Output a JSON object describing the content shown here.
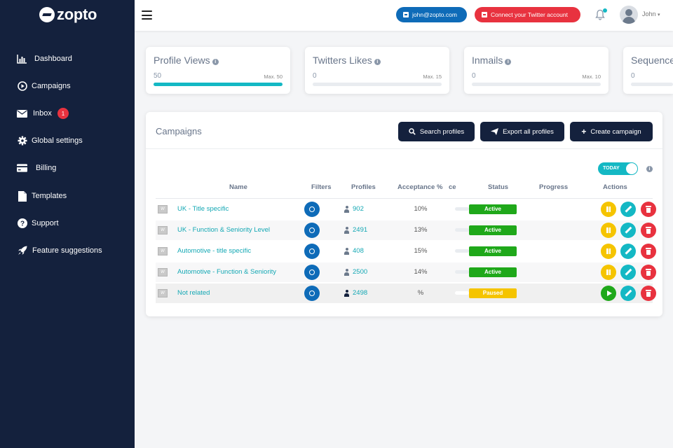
{
  "app": {
    "logo_text": "zopto"
  },
  "sidebar": {
    "items": [
      {
        "label": "Dashboard",
        "icon": "chart-bar-icon"
      },
      {
        "label": "Campaigns",
        "icon": "play-circle-icon"
      },
      {
        "label": "Inbox",
        "icon": "envelope-icon",
        "badge": "1"
      },
      {
        "label": "Global settings",
        "icon": "gear-icon"
      },
      {
        "label": "Billing",
        "icon": "credit-card-icon"
      },
      {
        "label": "Templates",
        "icon": "file-icon"
      },
      {
        "label": "Support",
        "icon": "question-circle-icon"
      },
      {
        "label": "Feature suggestions",
        "icon": "rocket-icon"
      }
    ]
  },
  "topbar": {
    "email_button": "john@zopto.com",
    "twitter_button": "Connect your Twitter account",
    "user_name": "John"
  },
  "stats": [
    {
      "title": "Profile Views",
      "value": "50",
      "max": "Max. 50",
      "progress": 1.0
    },
    {
      "title": "Twitters Likes",
      "value": "0",
      "max": "Max. 15",
      "progress": 0
    },
    {
      "title": "Inmails",
      "value": "0",
      "max": "Max. 10",
      "progress": 0
    },
    {
      "title": "Sequence",
      "value": "0",
      "max": "",
      "progress": 0
    }
  ],
  "campaigns": {
    "title": "Campaigns",
    "buttons": {
      "search": "Search profiles",
      "export": "Export all profiles",
      "create": "Create campaign"
    },
    "toggle_label": "TODAY",
    "columns": {
      "name": "Name",
      "filters": "Filters",
      "profiles": "Profiles",
      "acceptance": "Acceptance %",
      "extra": "ce",
      "status": "Status",
      "progress": "Progress",
      "actions": "Actions"
    },
    "rows": [
      {
        "name": "UK - Title specific",
        "profiles": "902",
        "acceptance": "10%",
        "status": "Active"
      },
      {
        "name": "UK - Function & Seniority Level",
        "profiles": "2491",
        "acceptance": "13%",
        "status": "Active"
      },
      {
        "name": "Automotive - title specific",
        "profiles": "408",
        "acceptance": "15%",
        "status": "Active"
      },
      {
        "name": "Automotive - Function & Seniority",
        "profiles": "2500",
        "acceptance": "14%",
        "status": "Active"
      },
      {
        "name": "Not related",
        "profiles": "2498",
        "acceptance": "%",
        "status": "Paused"
      }
    ]
  },
  "colors": {
    "sidebar_bg": "#14213d",
    "accent": "#14b8c4",
    "active": "#1fa81a",
    "paused": "#f5c400",
    "danger": "#e8323f",
    "primary": "#0e6bb8"
  }
}
